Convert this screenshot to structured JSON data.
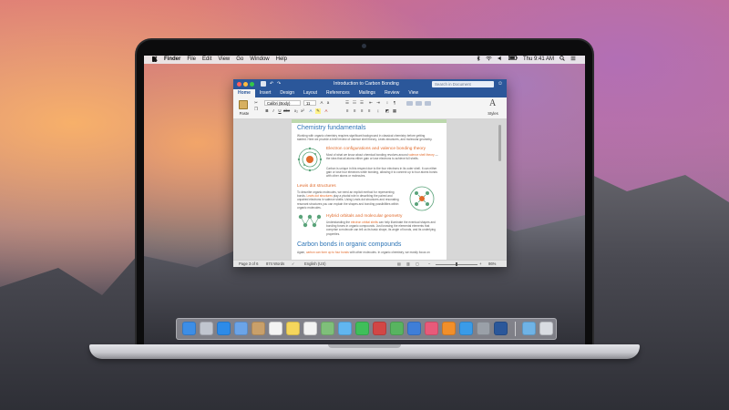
{
  "menubar": {
    "apple": "",
    "items": [
      "Finder",
      "File",
      "Edit",
      "View",
      "Go",
      "Window",
      "Help"
    ],
    "clock": "Thu 9:41 AM"
  },
  "word": {
    "title": "Introduction to Carbon Bonding",
    "search_placeholder": "Search in Document",
    "tabs": [
      "Home",
      "Insert",
      "Design",
      "Layout",
      "References",
      "Mailings",
      "Review",
      "View"
    ],
    "active_tab": "Home",
    "ribbon": {
      "paste": "Paste",
      "font": "Calibri (Body)",
      "size": "11",
      "bold": "B",
      "italic": "I",
      "underline": "U",
      "styles": "Styles",
      "styles_glyph": "A"
    },
    "doc": {
      "heading1": "Chemistry fundamentals",
      "para1": "Working with organic chemistry requires significant background in classical chemistry before getting started. Here we provide a brief review of valence shell theory, Lewis structures, and molecular geometry.",
      "sub1": "Electron configurations and valence bonding theory",
      "para2a": "Most of what we know about chemical bonding revolves around ",
      "para2_hl": "valence shell theory",
      "para2b": " — the idea that all atoms either gain or lose electrons to achieve full shells.",
      "para3": "Carbon is unique in this respect due to the four electrons in its outer shell. It can either gain or lose four electrons while bonding, allowing it to connect up to four atoms bonds with other atoms or molecules.",
      "sub2": "Lewis dot structures",
      "para4a": "To describe organic molecules, we need an explicit method for representing bonds. ",
      "para4_hl": "Lewis dot structures",
      "para4b": " play a pivotal role in describing the paired and unpaired electrons in valence shells. Using Lewis dot structures and resonating resonant structures you can explain the shapes and bonding possibilities within organic molecules.",
      "sub3": "Hybrid orbitals and molecular geometry",
      "para5a": "Understanding the ",
      "para5_hl": "electron orbital shells",
      "para5b": " can help illuminate the eventual shapes and bonding forces in organic compounds. Just knowing the elemental elements that comprise a molecule can tell us its basic shape, its angle of bonds, and its underlying properties.",
      "heading2": "Carbon bonds in organic compounds",
      "para6a": "Again, ",
      "para6_hl": "carbon can form up to four bonds",
      "para6b": " with other molecules. In organic chemistry, we mostly focus on"
    },
    "status": {
      "page": "Page 3 of 6",
      "words": "874 Words",
      "language": "English (US)",
      "zoom": "86%"
    }
  },
  "dock": {
    "apps": [
      {
        "name": "finder",
        "color": "#3d8ee6"
      },
      {
        "name": "launchpad",
        "color": "#c0c5cf"
      },
      {
        "name": "safari",
        "color": "#2d8be8"
      },
      {
        "name": "mail",
        "color": "#6ba4e8"
      },
      {
        "name": "contacts",
        "color": "#c9a06a"
      },
      {
        "name": "calendar",
        "color": "#f4f4f4"
      },
      {
        "name": "notes",
        "color": "#f5d65c"
      },
      {
        "name": "reminders",
        "color": "#f3f3f3"
      },
      {
        "name": "maps",
        "color": "#7fbf7a"
      },
      {
        "name": "messages",
        "color": "#61b6f0"
      },
      {
        "name": "facetime",
        "color": "#3fbf5a"
      },
      {
        "name": "photo-booth",
        "color": "#d24646"
      },
      {
        "name": "numbers",
        "color": "#58b460"
      },
      {
        "name": "keynote",
        "color": "#3f7ed8"
      },
      {
        "name": "itunes",
        "color": "#e85a7a"
      },
      {
        "name": "ibooks",
        "color": "#f28f2a"
      },
      {
        "name": "app-store",
        "color": "#3a9be8"
      },
      {
        "name": "system-preferences",
        "color": "#9aa0a8"
      },
      {
        "name": "word",
        "color": "#2b579a"
      },
      {
        "name": "downloads",
        "color": "#6fb3e6"
      },
      {
        "name": "trash",
        "color": "#d9dce2"
      }
    ]
  },
  "colors": {
    "word_blue": "#2b579a",
    "heading_blue": "#2e75b6",
    "accent_orange": "#e06a2b",
    "diagram_green": "#5aa37a"
  }
}
